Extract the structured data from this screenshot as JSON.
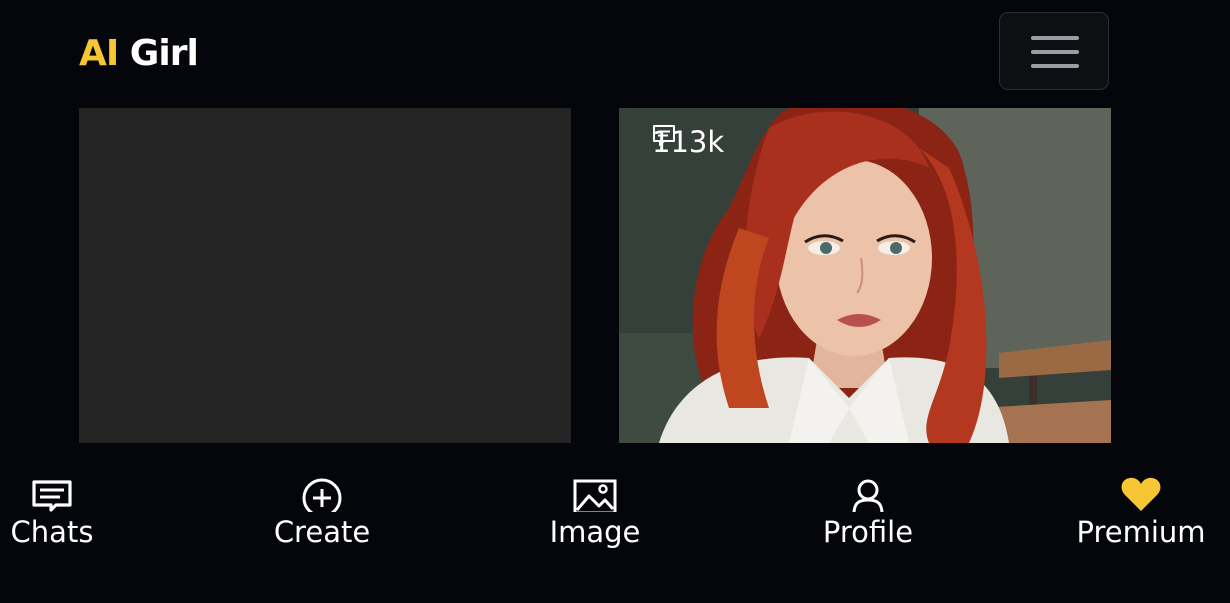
{
  "header": {
    "logo_accent": "AI",
    "logo_rest": " Girl",
    "menu_icon": "hamburger-menu-icon"
  },
  "cards": [
    {
      "image": "placeholder"
    },
    {
      "image": "portrait",
      "chat_count": "113k",
      "chat_icon": "message-icon"
    }
  ],
  "nav": {
    "items": [
      {
        "label": "Chats",
        "icon": "message-icon"
      },
      {
        "label": "Create",
        "icon": "plus-circle-icon"
      },
      {
        "label": "Image",
        "icon": "image-icon"
      },
      {
        "label": "Profile",
        "icon": "user-icon"
      },
      {
        "label": "Premium",
        "icon": "heart-icon"
      }
    ]
  },
  "colors": {
    "background": "#04060b",
    "accent": "#f7c634",
    "card_placeholder": "#242424"
  }
}
